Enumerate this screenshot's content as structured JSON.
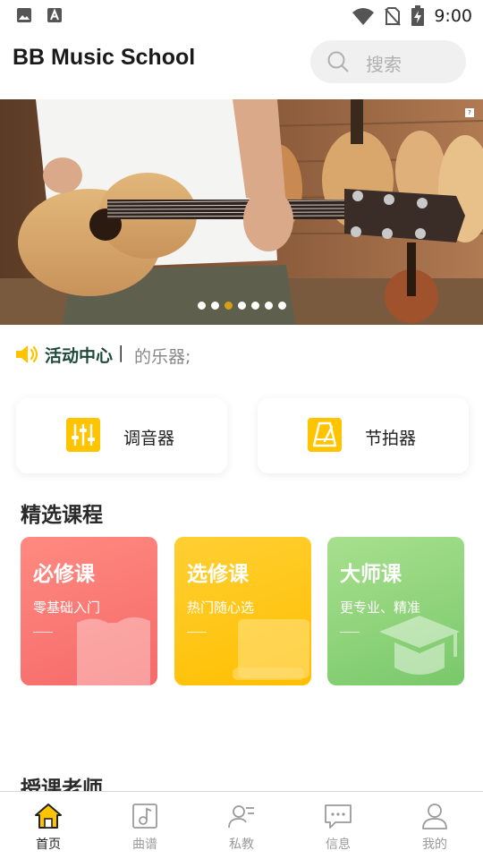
{
  "status_bar": {
    "time": "9:00",
    "left_icons": [
      "image-icon",
      "font-a-icon"
    ],
    "right_icons": [
      "wifi-icon",
      "no-sim-icon",
      "battery-charging-icon"
    ]
  },
  "header": {
    "title": "BB Music School",
    "search": {
      "placeholder": "搜索"
    }
  },
  "banner": {
    "image": "guitar-player-photo",
    "dots_count": 7,
    "active_dot": 3
  },
  "notice": {
    "icon": "speaker-icon",
    "title": "活动中心",
    "separator": "|",
    "text": "的乐器;"
  },
  "tools": [
    {
      "label": "调音器",
      "icon": "tuner-sliders-icon"
    },
    {
      "label": "节拍器",
      "icon": "metronome-icon"
    }
  ],
  "sections": {
    "courses_title": "精选课程",
    "teachers_title": "授课老师"
  },
  "courses": [
    {
      "title": "必修课",
      "subtitle": "零基础入门",
      "icon": "book-icon",
      "color": "#f56a6a"
    },
    {
      "title": "选修课",
      "subtitle": "热门随心选",
      "icon": "notebook-icon",
      "color": "#ffbf00"
    },
    {
      "title": "大师课",
      "subtitle": "更专业、精准",
      "icon": "graduation-cap-icon",
      "color": "#79c86a"
    }
  ],
  "bottom_nav": [
    {
      "label": "首页",
      "icon": "home-icon",
      "active": true
    },
    {
      "label": "曲谱",
      "icon": "music-score-icon",
      "active": false
    },
    {
      "label": "私教",
      "icon": "tutor-icon",
      "active": false
    },
    {
      "label": "信息",
      "icon": "message-icon",
      "active": false
    },
    {
      "label": "我的",
      "icon": "profile-icon",
      "active": false
    }
  ],
  "colors": {
    "accent": "#ffc400",
    "notice_title": "#1f4a3a",
    "active_dot": "#d4a017"
  }
}
